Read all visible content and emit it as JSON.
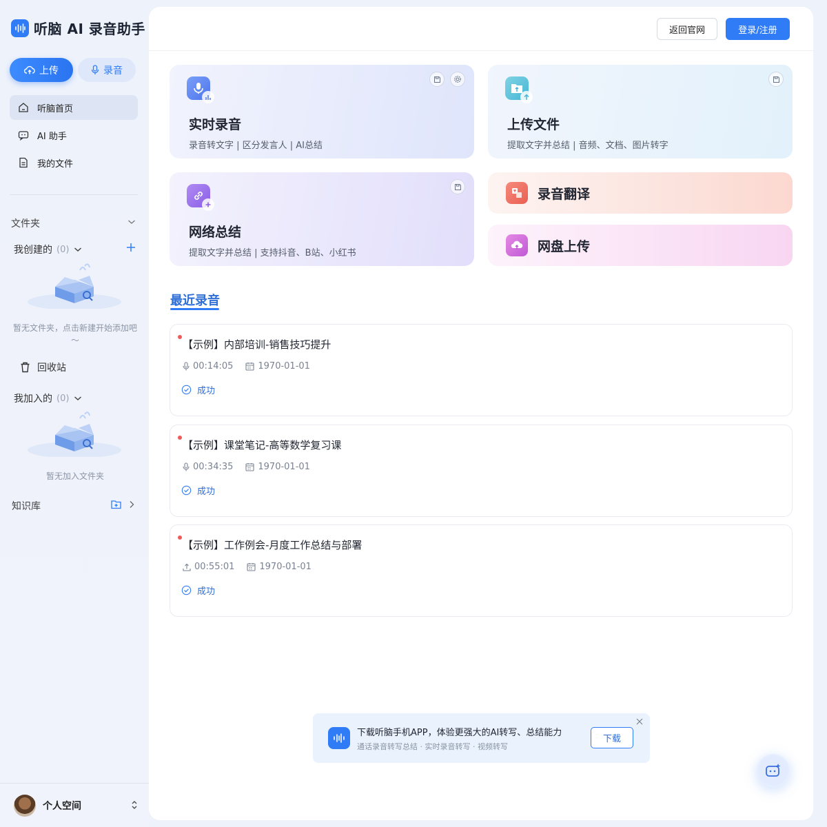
{
  "app": {
    "title": "听脑 AI 录音助手"
  },
  "sidebar": {
    "upload_label": "上传",
    "record_label": "录音",
    "nav": [
      {
        "label": "听脑首页",
        "icon": "home-icon",
        "active": true
      },
      {
        "label": "AI 助手",
        "icon": "chat-icon",
        "active": false
      },
      {
        "label": "我的文件",
        "icon": "file-icon",
        "active": false
      }
    ],
    "folders_title": "文件夹",
    "created": {
      "label": "我创建的",
      "count": "(0)",
      "empty_text": "暂无文件夹，点击新建开始添加吧～"
    },
    "recycle_label": "回收站",
    "joined": {
      "label": "我加入的",
      "count": "(0)",
      "empty_text": "暂无加入文件夹"
    },
    "knowledge_label": "知识库",
    "user_name": "个人空间"
  },
  "topbar": {
    "home_label": "返回官网",
    "login_label": "登录/注册"
  },
  "cards": {
    "realtime": {
      "title": "实时录音",
      "sub": "录音转文字 | 区分发言人 | AI总结"
    },
    "upload": {
      "title": "上传文件",
      "sub": "提取文字并总结 | 音频、文档、图片转字"
    },
    "web": {
      "title": "网络总结",
      "sub": "提取文字并总结 | 支持抖音、B站、小红书"
    },
    "translate": {
      "title": "录音翻译"
    },
    "cloud": {
      "title": "网盘上传"
    }
  },
  "recent": {
    "title": "最近录音",
    "items": [
      {
        "title": "【示例】内部培训-销售技巧提升",
        "duration": "00:14:05",
        "date": "1970-01-01",
        "status": "成功",
        "source_icon": "mic-icon"
      },
      {
        "title": "【示例】课堂笔记-高等数学复习课",
        "duration": "00:34:35",
        "date": "1970-01-01",
        "status": "成功",
        "source_icon": "mic-icon"
      },
      {
        "title": "【示例】工作例会-月度工作总结与部署",
        "duration": "00:55:01",
        "date": "1970-01-01",
        "status": "成功",
        "source_icon": "upload-icon"
      }
    ]
  },
  "download": {
    "title": "下载听脑手机APP，体验更强大的AI转写、总结能力",
    "sub": "通话录音转写总结 · 实时录音转写 · 视频转写",
    "button": "下载"
  },
  "colors": {
    "accent": "#2f7cf6",
    "status_dot": "#ef5b5b"
  }
}
